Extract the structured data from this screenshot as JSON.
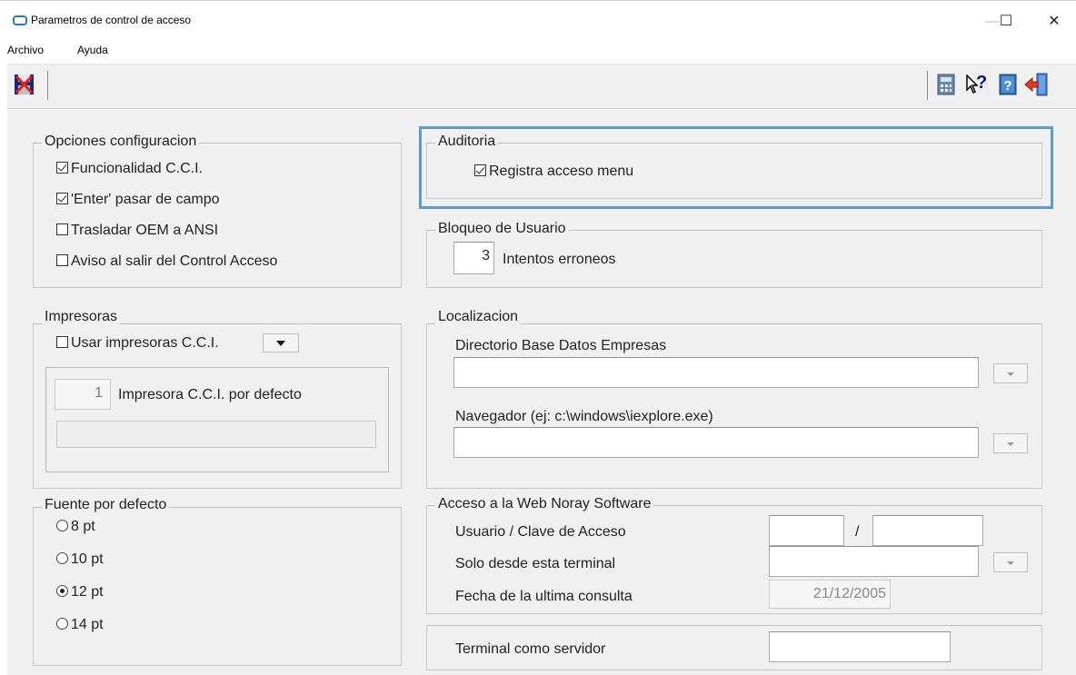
{
  "window": {
    "title": "Parametros de control de acceso",
    "controls": {
      "minimize": "—",
      "maximize": "☐",
      "close": "✕"
    }
  },
  "menu": {
    "items": [
      "Archivo",
      "Ayuda"
    ]
  },
  "toolbar": {
    "left_icons": [
      "save-exit-icon"
    ],
    "right_icons": [
      "calculator-icon",
      "whats-this-help-icon",
      "help-book-icon",
      "exit-door-icon"
    ],
    "help_glyph": "?"
  },
  "opciones": {
    "title": "Opciones configuracion",
    "items": [
      {
        "label": "Funcionalidad C.C.I.",
        "checked": true
      },
      {
        "label": "'Enter' pasar de campo",
        "checked": true
      },
      {
        "label": "Trasladar OEM a ANSI",
        "checked": false
      },
      {
        "label": "Aviso al salir del Control Acceso",
        "checked": false
      }
    ]
  },
  "auditoria": {
    "title": "Auditoria",
    "item": {
      "label": "Registra acceso menu",
      "checked": true
    },
    "highlight_color": "#5b9bd5"
  },
  "bloqueo": {
    "title": "Bloqueo de Usuario",
    "intentos_value": "3",
    "intentos_label": "Intentos erroneos"
  },
  "impresoras": {
    "title": "Impresoras",
    "usar_label": "Usar impresoras C.C.I.",
    "usar_checked": false,
    "defecto_value": "1",
    "defecto_label": "Impresora C.C.I. por defecto",
    "defecto_name": ""
  },
  "localizacion": {
    "title": "Localizacion",
    "dir_label": "Directorio Base Datos Empresas",
    "dir_value": "",
    "nav_label": "Navegador (ej: c:\\windows\\iexplore.exe)",
    "nav_value": ""
  },
  "fuente": {
    "title": "Fuente por defecto",
    "options": [
      {
        "label": "8 pt",
        "selected": false
      },
      {
        "label": "10 pt",
        "selected": false
      },
      {
        "label": "12 pt",
        "selected": true
      },
      {
        "label": "14 pt",
        "selected": false
      }
    ]
  },
  "web": {
    "title": "Acceso a la Web Noray Software",
    "usuario_label": "Usuario / Clave de Acceso",
    "usuario_value": "",
    "separator": "/",
    "clave_value": "",
    "terminal_label": "Solo desde esta terminal",
    "terminal_value": "",
    "fecha_label": "Fecha de la ultima consulta",
    "fecha_value": "21/12/2005"
  },
  "servidor": {
    "label": "Terminal como servidor",
    "value": ""
  }
}
